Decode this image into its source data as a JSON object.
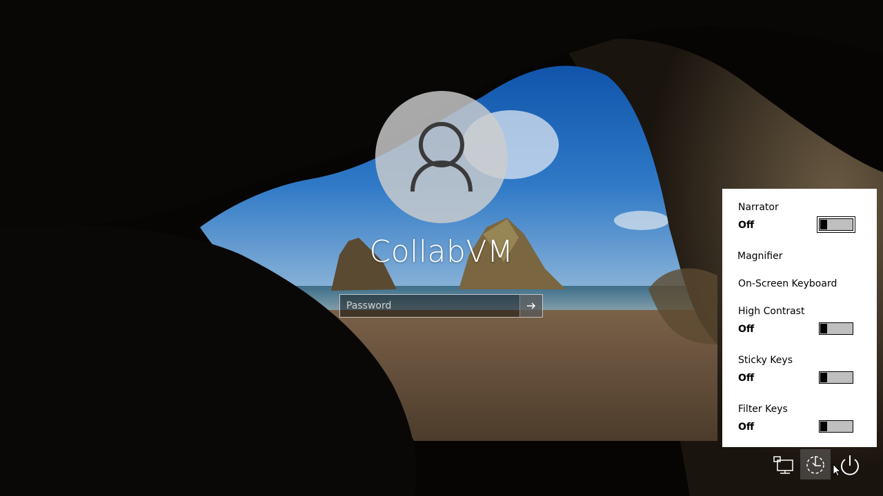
{
  "user": {
    "name": "CollabVM"
  },
  "password": {
    "placeholder": "Password",
    "value": ""
  },
  "ease_of_access": {
    "items": [
      {
        "label": "Narrator",
        "state": "Off"
      },
      {
        "label": "Magnifier"
      },
      {
        "label": "On-Screen Keyboard"
      },
      {
        "label": "High Contrast",
        "state": "Off"
      },
      {
        "label": "Sticky Keys",
        "state": "Off"
      },
      {
        "label": "Filter Keys",
        "state": "Off"
      }
    ]
  },
  "tray": {
    "network_icon": "network-icon",
    "ease_icon": "ease-of-access-icon",
    "power_icon": "power-icon"
  },
  "colors": {
    "panel_bg": "#ffffff",
    "toggle_off": "#bfbfbf"
  }
}
